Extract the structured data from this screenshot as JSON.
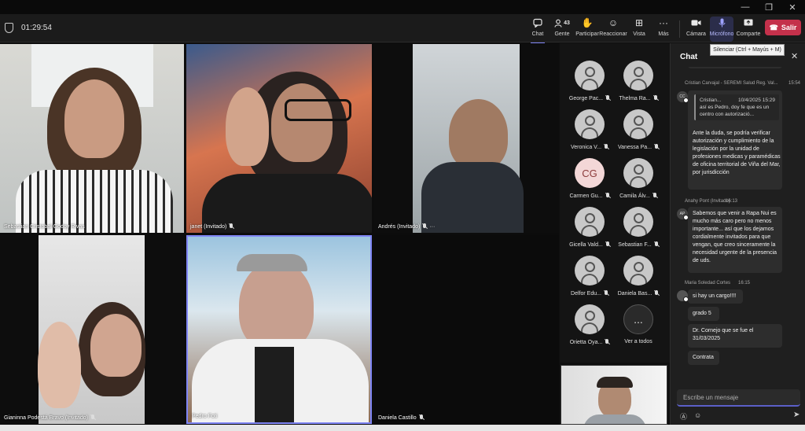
{
  "meeting": {
    "timer": "01:29:54"
  },
  "toolbar": {
    "chat": "Chat",
    "people": "Gente",
    "people_count": "43",
    "raise": "Participar",
    "react": "Reaccionar",
    "view": "Vista",
    "more": "Más",
    "camera": "Cámara",
    "mic": "Micrófono",
    "share": "Comparte",
    "leave": "Salir",
    "mic_tooltip": "Silenciar (Ctrl + Mayús + M)"
  },
  "tiles": [
    {
      "name": "Sebastian Cristobal Godoy Rivas"
    },
    {
      "name": "janet (Invitado)"
    },
    {
      "name": "Andrés (Invitado)"
    },
    {
      "name": "Gianinna Podestá Bravo (Invitado)"
    },
    {
      "name": "Pedro Foti"
    },
    {
      "name": "Daniela Castillo"
    }
  ],
  "roster": [
    {
      "name": "George Pac...",
      "initials": ""
    },
    {
      "name": "Thelma Ra...",
      "initials": ""
    },
    {
      "name": "Veronica V...",
      "initials": ""
    },
    {
      "name": "Vanessa Pa...",
      "initials": ""
    },
    {
      "name": "Carmen Gu...",
      "initials": "CG"
    },
    {
      "name": "Camila Álv...",
      "initials": ""
    },
    {
      "name": "Gicella Vald...",
      "initials": ""
    },
    {
      "name": "Sebastian F...",
      "initials": ""
    },
    {
      "name": "Delfor Edu...",
      "initials": ""
    },
    {
      "name": "Daniela Bas...",
      "initials": ""
    },
    {
      "name": "Orietta Oya...",
      "initials": ""
    },
    {
      "name": "Ver a todos",
      "initials": "..."
    }
  ],
  "chat": {
    "title": "Chat",
    "compose_placeholder": "Escribe un mensaje",
    "messages": [
      {
        "author": "Cristian Carvajal - SEREMI Salud Reg. Val...",
        "time": "15:54",
        "avatar": "CC",
        "quote_author": "Cristian...",
        "quote_time": "10/4/2025 15:29",
        "quote_text": "así es Pedro, doy fe que es un centro con autorizació...",
        "text": "Ante la duda, se podría verificar autorización y cumplimiento de la legislación por la unidad de profesiones medicas y paramédicas de oficina territorial de Viña del Mar, por jurisdicción"
      },
      {
        "author": "Anahy Pont (Invitado)",
        "time": "16:13",
        "avatar": "AP",
        "text": "Sabemos que venir a Rapa Nui es mucho más caro pero no menos importante... así que los dejamos cordialmente invitados para que vengan, que creo sinceramente la necesidad urgente de la presencia de uds."
      },
      {
        "author": "Maria Soledad Cortes",
        "time": "16:15",
        "avatar": "",
        "text": "si hay un cargo!!!!"
      },
      {
        "text": "grado 5"
      },
      {
        "text": "Dr. Cornejo que se fue el 31/03/2025"
      },
      {
        "text": "Contrata"
      }
    ]
  },
  "colors": {
    "accent": "#5b5fc7",
    "leave": "#c4314b",
    "panel": "#1f1f1f"
  }
}
